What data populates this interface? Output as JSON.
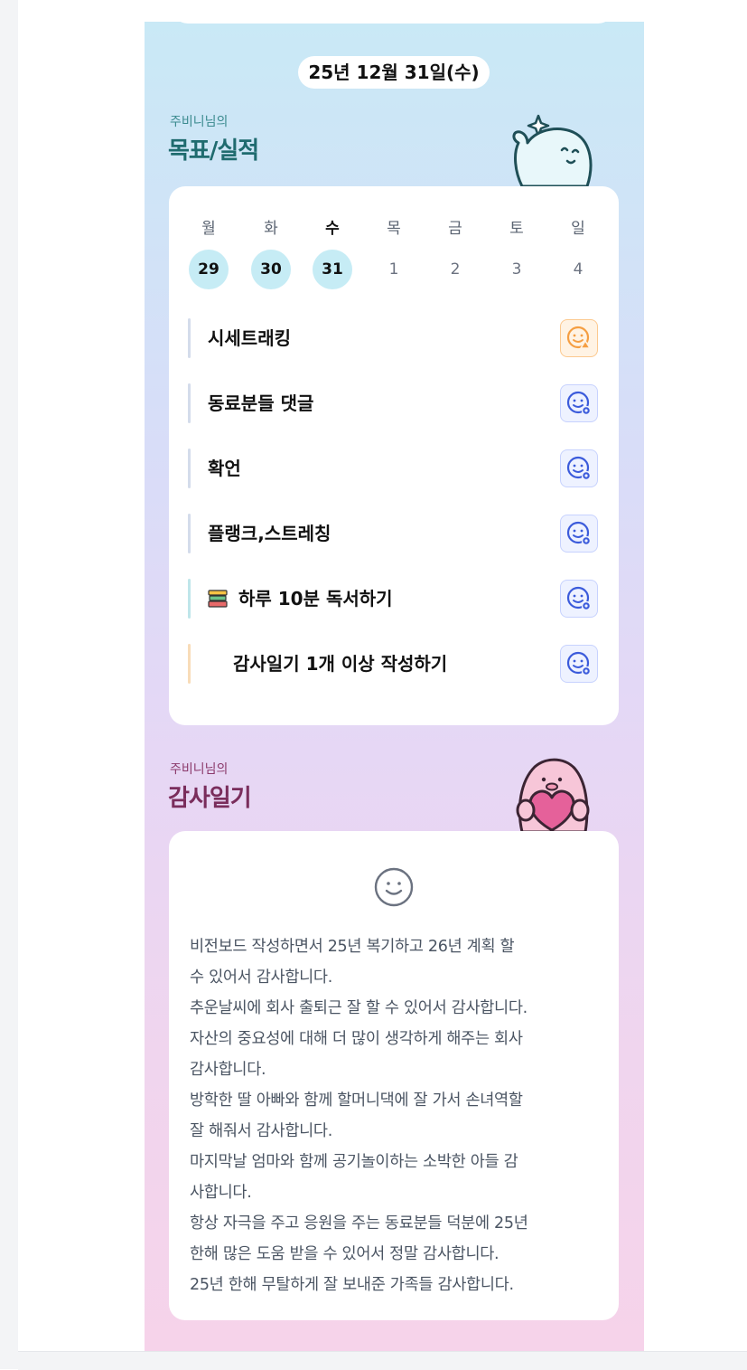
{
  "header": {
    "date": "25년 12월 31일(수)"
  },
  "goals_section": {
    "owner": "주비니님의",
    "title": "목표/실적",
    "weekdays": [
      "월",
      "화",
      "수",
      "목",
      "금",
      "토",
      "일"
    ],
    "dates": [
      "29",
      "30",
      "31",
      "1",
      "2",
      "3",
      "4"
    ],
    "current_day_index": 2,
    "completed_day_indices": [
      0,
      1,
      2
    ],
    "items": [
      {
        "label": "시세트래킹",
        "status_icon": "face-warning-icon",
        "status_color": "#f59e42"
      },
      {
        "label": "동료분들 댓글",
        "status_icon": "face-check-icon",
        "status_color": "#3b5bdb"
      },
      {
        "label": "확언",
        "status_icon": "face-check-icon",
        "status_color": "#3b5bdb"
      },
      {
        "label": "플랭크,스트레칭",
        "status_icon": "face-check-icon",
        "status_color": "#3b5bdb"
      },
      {
        "label": "하루 10분 독서하기",
        "leading_icon": "books-icon",
        "status_icon": "face-check-icon",
        "status_color": "#3b5bdb"
      },
      {
        "label": "감사일기 1개 이상 작성하기",
        "status_icon": "face-check-icon",
        "status_color": "#3b5bdb"
      }
    ]
  },
  "gratitude_section": {
    "owner": "주비니님의",
    "title": "감사일기",
    "mood_icon": "smile-face-icon",
    "lines": [
      "비전보드 작성하면서 25년 복기하고 26년 계획 할",
      "수 있어서 감사합니다.",
      "추운날씨에 회사 출퇴근 잘 할 수 있어서 감사합니다.",
      "자산의 중요성에 대해 더 많이 생각하게 해주는 회사",
      "감사합니다.",
      "방학한 딸 아빠와 함께 할머니댁에 잘 가서 손녀역할",
      "잘 해줘서 감사합니다.",
      "마지막날 엄마와 함께 공기놀이하는 소박한 아들 감",
      "사합니다.",
      "항상 자극을 주고 응원을 주는 동료분들 덕분에 25년",
      "한해 많은 도움 받을 수 있어서 정말 감사합니다.",
      "25년 한해 무탈하게 잘 보내준 가족들 감사합니다."
    ]
  },
  "colors": {
    "goal_title": "#1f6b6f",
    "goal_owner": "#3a8a8e",
    "gratitude_title": "#7a2d5c",
    "gratitude_owner": "#8b3a6b",
    "completed_day_bg": "#c6ecf5",
    "accent_blue": "#3b5bdb",
    "accent_orange": "#f59e42"
  }
}
